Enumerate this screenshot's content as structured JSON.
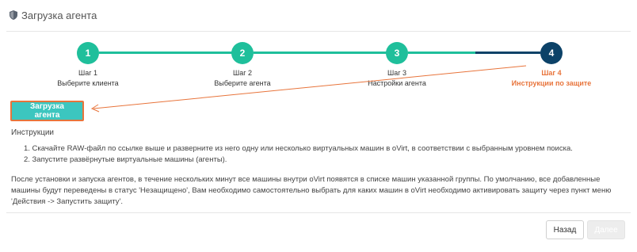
{
  "header": {
    "title": "Загрузка агента",
    "icon": "shield-icon"
  },
  "colors": {
    "completed": "#1fbf9b",
    "active": "#0c4268",
    "active_text": "#e8743b",
    "button_bg": "#3cc6bf"
  },
  "steps": [
    {
      "number": "1",
      "title": "Шаг 1",
      "subtitle": "Выберите клиента",
      "state": "completed"
    },
    {
      "number": "2",
      "title": "Шаг 2",
      "subtitle": "Выберите агента",
      "state": "completed"
    },
    {
      "number": "3",
      "title": "Шаг 3",
      "subtitle": "Настройки агента",
      "state": "completed"
    },
    {
      "number": "4",
      "title": "Шаг 4",
      "subtitle": "Инструкции по защите",
      "state": "active"
    }
  ],
  "download_button": "Загрузка агента",
  "instructions": {
    "title": "Инструкции",
    "items": [
      "1. Скачайте RAW-файл по ссылке выше и разверните из него одну или несколько виртуальных машин в oVirt, в соответствии с выбранным уровнем поиска.",
      "2. Запустите развёрнутые виртуальные машины (агенты)."
    ],
    "paragraph": "После установки и запуска агентов, в течение нескольких минут все машины внутри oVirt появятся в списке машин указанной группы. По умолчанию, все добавленные машины будут переведены в статус 'Незащищено', Вам необходимо самостоятельно выбрать для каких машин в oVirt необходимо активировать защиту через пункт меню 'Действия -> Запустить защиту'."
  },
  "footer": {
    "back": "Назад",
    "next": "Далее"
  }
}
